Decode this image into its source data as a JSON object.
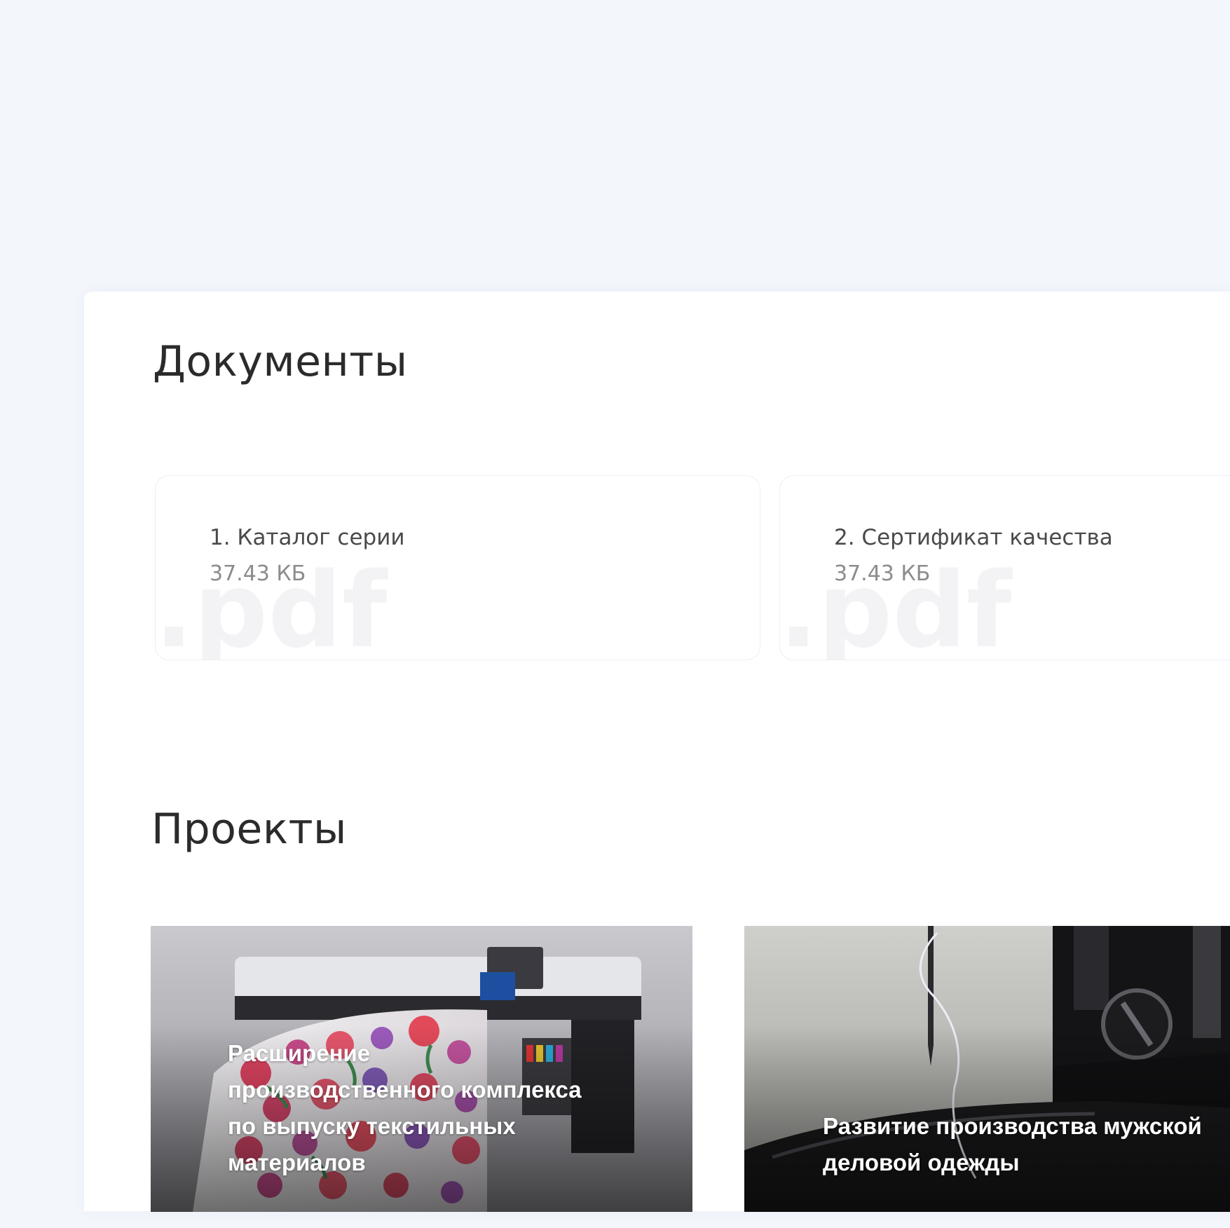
{
  "documents": {
    "title": "Документы",
    "items": [
      {
        "name": "1. Каталог серии",
        "size": "37.43 КБ",
        "ext": ".pdf"
      },
      {
        "name": "2. Сертификат качества",
        "size": "37.43 КБ",
        "ext": ".pdf"
      }
    ]
  },
  "projects": {
    "title": "Проекты",
    "items": [
      {
        "title": "Расширение производственного комплекса по выпуску текстильных материалов",
        "image": "printer-photo"
      },
      {
        "title": "Развитие производства мужской деловой одежды",
        "image": "sewing-machine-photo"
      }
    ]
  }
}
